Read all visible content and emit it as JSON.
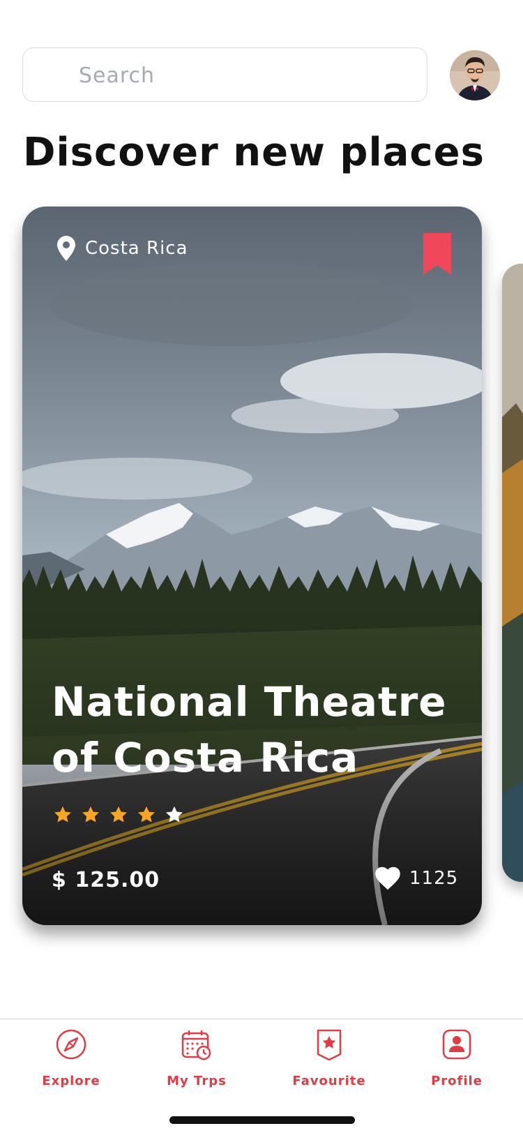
{
  "search": {
    "placeholder": "Search"
  },
  "header": {
    "title": "Discover new places"
  },
  "card": {
    "location": "Costa Rica",
    "title": "National Theatre of Costa Rica",
    "rating": {
      "value": 4,
      "max": 5
    },
    "price": "$ 125.00",
    "likes": "1125",
    "bookmarked": true
  },
  "nav": {
    "items": [
      {
        "label": "Explore",
        "icon": "compass-icon"
      },
      {
        "label": "My Trps",
        "icon": "calendar-clock-icon"
      },
      {
        "label": "Favourite",
        "icon": "star-shield-icon"
      },
      {
        "label": "Profile",
        "icon": "user-icon"
      }
    ]
  },
  "colors": {
    "accent": "#e23b44",
    "star": "#f5a623",
    "bookmark": "#f0485a"
  }
}
